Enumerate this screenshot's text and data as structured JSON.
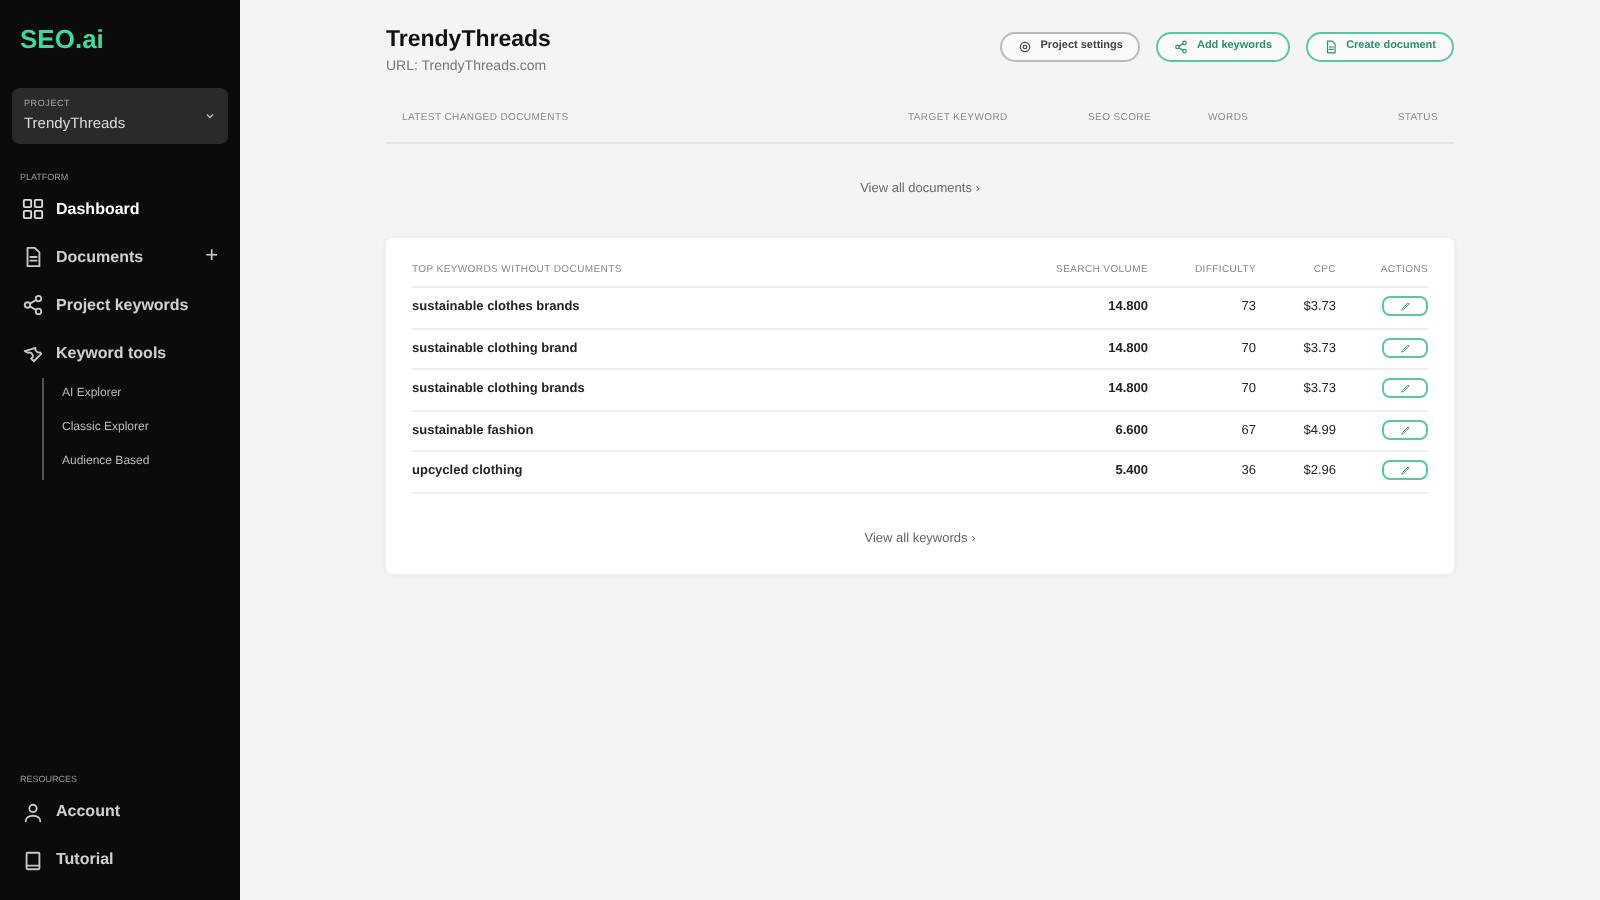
{
  "sidebar": {
    "logo": "SEO.ai",
    "project": {
      "label": "PROJECT",
      "value": "TrendyThreads"
    },
    "sections": [
      {
        "label": "PLATFORM",
        "items": [
          {
            "label": "Dashboard",
            "selected": true
          },
          {
            "label": "Documents",
            "selected": false,
            "add": "+"
          },
          {
            "label": "Project keywords",
            "selected": false
          },
          {
            "label": "Keyword tools",
            "selected": false,
            "children": [
              {
                "label": "AI Explorer"
              },
              {
                "label": "Classic Explorer"
              },
              {
                "label": "Audience Based"
              }
            ]
          }
        ]
      },
      {
        "label": "RESOURCES",
        "items": [
          {
            "label": "Account",
            "selected": false
          },
          {
            "label": "Tutorial",
            "selected": false
          }
        ]
      }
    ]
  },
  "header": {
    "title": "TrendyThreads",
    "url": "URL: TrendyThreads.com",
    "buttons": [
      {
        "label": "Project settings",
        "kind": "neutral"
      },
      {
        "label": "Add keywords",
        "kind": "accent"
      },
      {
        "label": "Create document",
        "kind": "accent"
      }
    ]
  },
  "documents": {
    "columns": [
      "LATEST CHANGED DOCUMENTS",
      "TARGET KEYWORD",
      "SEO SCORE",
      "WORDS",
      "STATUS"
    ],
    "link": "View all documents ›"
  },
  "keywords": {
    "columns": [
      "TOP KEYWORDS WITHOUT DOCUMENTS",
      "SEARCH VOLUME",
      "DIFFICULTY",
      "CPC",
      "ACTIONS"
    ],
    "rows": [
      {
        "keyword": "sustainable clothes brands",
        "volume": "14.800",
        "difficulty": "73",
        "cpc": "$3.73"
      },
      {
        "keyword": "sustainable clothing brand",
        "volume": "14.800",
        "difficulty": "70",
        "cpc": "$3.73"
      },
      {
        "keyword": "sustainable clothing brands",
        "volume": "14.800",
        "difficulty": "70",
        "cpc": "$3.73"
      },
      {
        "keyword": "sustainable fashion",
        "volume": "6.600",
        "difficulty": "67",
        "cpc": "$4.99"
      },
      {
        "keyword": "upcycled clothing",
        "volume": "5.400",
        "difficulty": "36",
        "cpc": "$2.96"
      }
    ],
    "link": "View all keywords ›"
  }
}
